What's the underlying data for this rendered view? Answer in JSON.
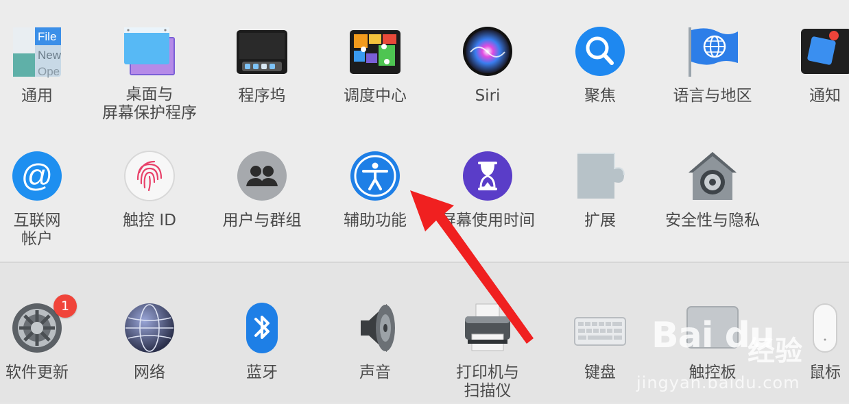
{
  "colors": {
    "badge": "#f0443a",
    "arrow": "#f02020",
    "label": "#4a4a4a"
  },
  "row1": [
    {
      "label": "通用",
      "icon": "general-icon"
    },
    {
      "label": "桌面与\n屏幕保护程序",
      "icon": "desktop-screensaver-icon"
    },
    {
      "label": "程序坞",
      "icon": "dock-icon"
    },
    {
      "label": "调度中心",
      "icon": "mission-control-icon"
    },
    {
      "label": "Siri",
      "icon": "siri-icon"
    },
    {
      "label": "聚焦",
      "icon": "spotlight-icon"
    },
    {
      "label": "语言与地区",
      "icon": "language-region-icon"
    },
    {
      "label": "通知",
      "icon": "notifications-icon"
    }
  ],
  "general_icon_text": [
    "File",
    "New",
    "Ope"
  ],
  "row2": [
    {
      "label": "互联网\n帐户",
      "icon": "internet-accounts-icon"
    },
    {
      "label": "触控 ID",
      "icon": "touch-id-icon"
    },
    {
      "label": "用户与群组",
      "icon": "users-groups-icon"
    },
    {
      "label": "辅助功能",
      "icon": "accessibility-icon"
    },
    {
      "label": "屏幕使用时间",
      "icon": "screen-time-icon"
    },
    {
      "label": "扩展",
      "icon": "extensions-icon"
    },
    {
      "label": "安全性与隐私",
      "icon": "security-privacy-icon"
    }
  ],
  "row3": [
    {
      "label": "软件更新",
      "icon": "software-update-icon",
      "badge": "1"
    },
    {
      "label": "网络",
      "icon": "network-icon"
    },
    {
      "label": "蓝牙",
      "icon": "bluetooth-icon"
    },
    {
      "label": "声音",
      "icon": "sound-icon"
    },
    {
      "label": "打印机与\n扫描仪",
      "icon": "printers-scanners-icon"
    },
    {
      "label": "键盘",
      "icon": "keyboard-icon"
    },
    {
      "label": "触控板",
      "icon": "trackpad-icon"
    },
    {
      "label": "鼠标",
      "icon": "mouse-icon"
    }
  ],
  "watermark": {
    "logo": "Bai du",
    "brand": "经验",
    "url": "jingyan.baidu.com"
  }
}
